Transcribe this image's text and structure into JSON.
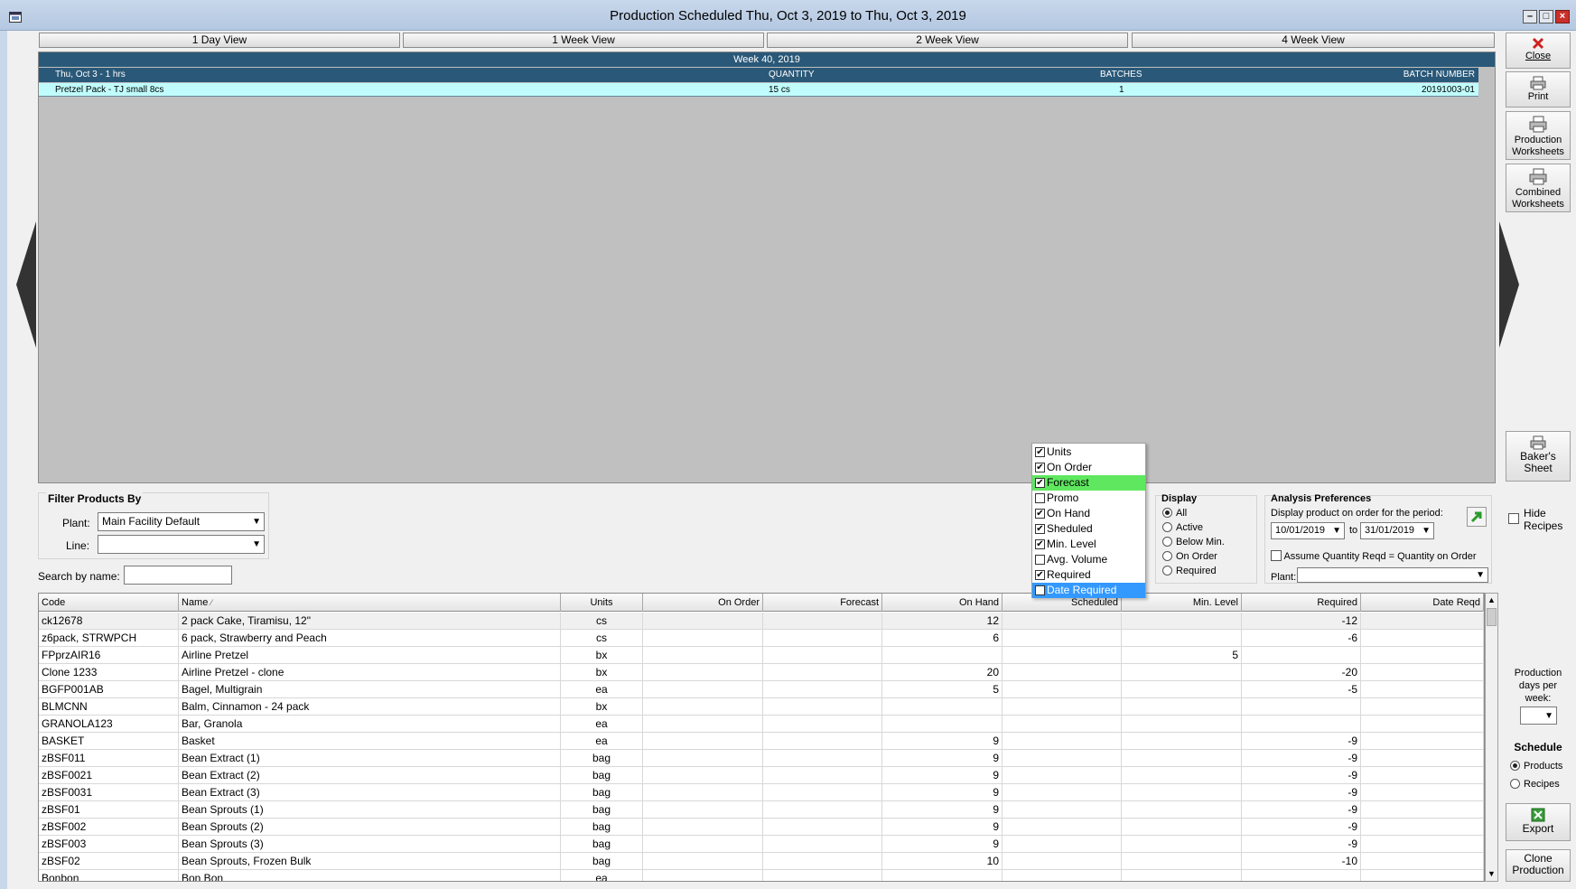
{
  "window": {
    "title": "Production Scheduled Thu, Oct 3, 2019 to Thu, Oct 3, 2019"
  },
  "view_tabs": [
    "1 Day View",
    "1 Week View",
    "2 Week View",
    "4 Week View"
  ],
  "schedule": {
    "week_label": "Week 40, 2019",
    "day_header": "Thu, Oct 3 - 1 hrs",
    "col_quantity": "QUANTITY",
    "col_batches": "BATCHES",
    "col_batch_number": "BATCH NUMBER",
    "row": {
      "product": "Pretzel Pack - TJ small 8cs",
      "quantity": "15 cs",
      "batches": "1",
      "batch_number": "20191003-01"
    }
  },
  "side_buttons": {
    "close": "Close",
    "print": "Print",
    "production_worksheets": [
      "Production",
      "Worksheets"
    ],
    "combined_worksheets": [
      "Combined",
      "Worksheets"
    ],
    "bakers_sheet": [
      "Baker's",
      "Sheet"
    ],
    "export": "Export",
    "clone_production": [
      "Clone",
      "Production"
    ]
  },
  "filter": {
    "title": "Filter Products By",
    "plant_label": "Plant:",
    "plant_value": "Main Facility Default",
    "line_label": "Line:",
    "line_value": "",
    "search_label": "Search by name:",
    "search_value": ""
  },
  "column_menu": [
    {
      "label": "Units",
      "checked": true,
      "state": ""
    },
    {
      "label": "On Order",
      "checked": true,
      "state": ""
    },
    {
      "label": "Forecast",
      "checked": true,
      "state": "green"
    },
    {
      "label": "Promo",
      "checked": false,
      "state": ""
    },
    {
      "label": "On Hand",
      "checked": true,
      "state": ""
    },
    {
      "label": "Sheduled",
      "checked": true,
      "state": ""
    },
    {
      "label": "Min. Level",
      "checked": true,
      "state": ""
    },
    {
      "label": "Avg. Volume",
      "checked": false,
      "state": ""
    },
    {
      "label": "Required",
      "checked": true,
      "state": ""
    },
    {
      "label": "Date Required",
      "checked": true,
      "state": "blue"
    }
  ],
  "display": {
    "title": "Display",
    "options": [
      "All",
      "Active",
      "Below Min.",
      "On Order",
      "Required"
    ],
    "selected": "All"
  },
  "analysis": {
    "title": "Analysis Preferences",
    "period_label": "Display product on order for the period:",
    "from": "10/01/2019",
    "to_label": "to",
    "to": "31/01/2019",
    "assume_label": "Assume Quantity Reqd = Quantity on Order",
    "plant_label": "Plant:",
    "plant_value": ""
  },
  "hide_recipes": [
    "Hide",
    "Recipes"
  ],
  "production_days": {
    "label": [
      "Production",
      "days per",
      "week:"
    ],
    "value": ""
  },
  "schedule_mode": {
    "title": "Schedule",
    "options": [
      "Products",
      "Recipes"
    ],
    "selected": "Products"
  },
  "grid": {
    "columns": [
      "Code",
      "Name",
      "Units",
      "On Order",
      "Forecast",
      "On Hand",
      "Scheduled",
      "Min. Level",
      "Required",
      "Date Reqd"
    ],
    "sort_indicator": "⁄",
    "rows": [
      [
        "ck12678",
        "2 pack Cake, Tiramisu, 12\"",
        "cs",
        "",
        "",
        "12",
        "",
        "",
        "-12",
        ""
      ],
      [
        "z6pack, STRWPCH",
        "6 pack, Strawberry and Peach",
        "cs",
        "",
        "",
        "6",
        "",
        "",
        "-6",
        ""
      ],
      [
        "FPprzAIR16",
        "Airline Pretzel",
        "bx",
        "",
        "",
        "",
        "",
        "5",
        "",
        ""
      ],
      [
        "Clone 1233",
        "Airline Pretzel - clone",
        "bx",
        "",
        "",
        "20",
        "",
        "",
        "-20",
        ""
      ],
      [
        "BGFP001AB",
        "Bagel, Multigrain",
        "ea",
        "",
        "",
        "5",
        "",
        "",
        "-5",
        ""
      ],
      [
        "BLMCNN",
        "Balm, Cinnamon - 24 pack",
        "bx",
        "",
        "",
        "",
        "",
        "",
        "",
        ""
      ],
      [
        "GRANOLA123",
        "Bar, Granola",
        "ea",
        "",
        "",
        "",
        "",
        "",
        "",
        ""
      ],
      [
        "BASKET",
        "Basket",
        "ea",
        "",
        "",
        "9",
        "",
        "",
        "-9",
        ""
      ],
      [
        "zBSF011",
        "Bean Extract (1)",
        "bag",
        "",
        "",
        "9",
        "",
        "",
        "-9",
        ""
      ],
      [
        "zBSF0021",
        "Bean Extract (2)",
        "bag",
        "",
        "",
        "9",
        "",
        "",
        "-9",
        ""
      ],
      [
        "zBSF0031",
        "Bean Extract (3)",
        "bag",
        "",
        "",
        "9",
        "",
        "",
        "-9",
        ""
      ],
      [
        "zBSF01",
        "Bean Sprouts (1)",
        "bag",
        "",
        "",
        "9",
        "",
        "",
        "-9",
        ""
      ],
      [
        "zBSF002",
        "Bean Sprouts (2)",
        "bag",
        "",
        "",
        "9",
        "",
        "",
        "-9",
        ""
      ],
      [
        "zBSF003",
        "Bean Sprouts (3)",
        "bag",
        "",
        "",
        "9",
        "",
        "",
        "-9",
        ""
      ],
      [
        "zBSF02",
        "Bean Sprouts, Frozen Bulk",
        "bag",
        "",
        "",
        "10",
        "",
        "",
        "-10",
        ""
      ],
      [
        "Bonbon",
        "Bon Bon",
        "ea",
        "",
        "",
        "",
        "",
        "",
        "",
        ""
      ]
    ]
  },
  "colors": {
    "schedule_header": "#2a5878",
    "schedule_row": "#c0fcfc",
    "menu_green": "#5fe85f",
    "menu_blue": "#3399ff"
  }
}
